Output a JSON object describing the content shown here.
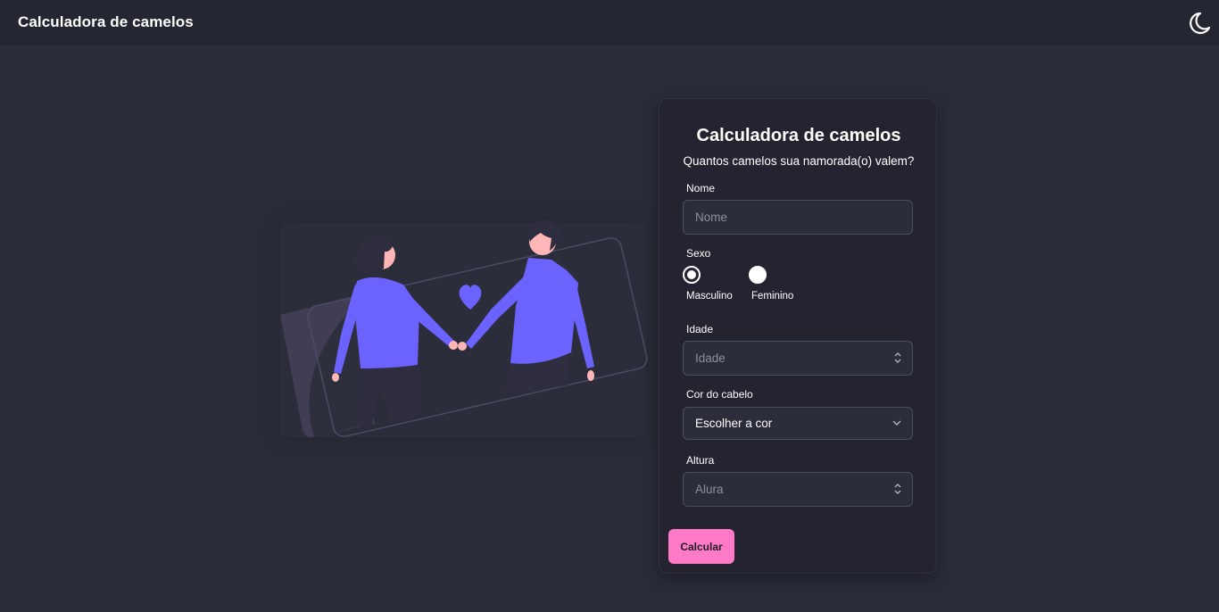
{
  "header": {
    "title": "Calculadora de camelos",
    "theme_icon": "moon-icon"
  },
  "card": {
    "title": "Calculadora de camelos",
    "subtitle": "Quantos camelos sua namorada(o) valem?",
    "name": {
      "label": "Nome",
      "placeholder": "Nome",
      "value": ""
    },
    "sex": {
      "label": "Sexo",
      "options": [
        {
          "label": "Masculino",
          "checked": true
        },
        {
          "label": "Feminino",
          "checked": false
        }
      ]
    },
    "age": {
      "label": "Idade",
      "placeholder": "Idade",
      "value": ""
    },
    "hair_color": {
      "label": "Cor do cabelo",
      "selected": "Escolher a cor"
    },
    "height": {
      "label": "Altura",
      "placeholder": "Alura",
      "value": ""
    },
    "submit_label": "Calcular"
  },
  "colors": {
    "background": "#2a2c39",
    "header": "#242631",
    "card": "#23242f",
    "accent_button": "#ff7ac6",
    "illustration_purple": "#6c63ff"
  }
}
